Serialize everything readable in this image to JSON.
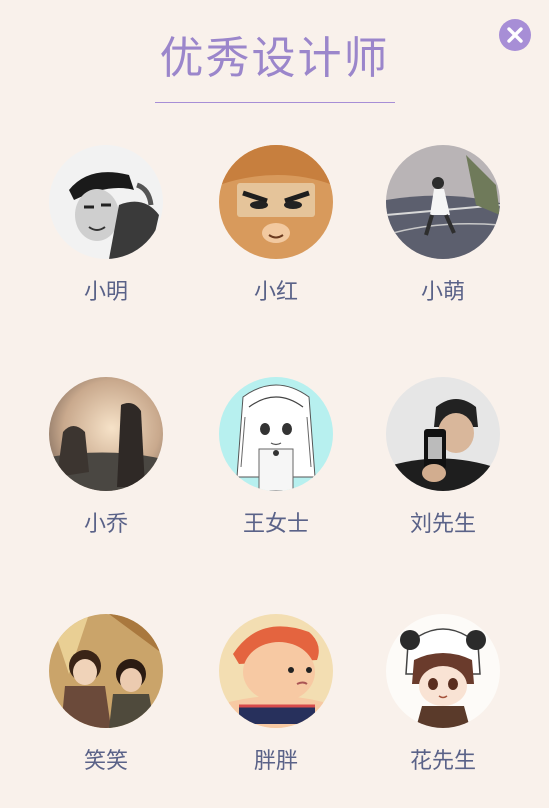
{
  "dialog": {
    "title": "优秀设计师",
    "close_icon": "close-icon",
    "accent_color": "#a78ed6",
    "background_color": "#f9f1eb"
  },
  "designers": [
    {
      "name": "小明"
    },
    {
      "name": "小红"
    },
    {
      "name": "小萌"
    },
    {
      "name": "小乔"
    },
    {
      "name": "王女士"
    },
    {
      "name": "刘先生"
    },
    {
      "name": "笑笑"
    },
    {
      "name": "胖胖"
    },
    {
      "name": "花先生"
    }
  ]
}
